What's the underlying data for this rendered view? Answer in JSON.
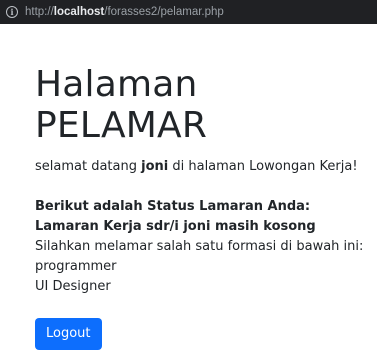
{
  "browser": {
    "url_scheme": "http://",
    "url_host": "localhost",
    "url_path": "/forasses2/pelamar.php"
  },
  "page": {
    "title": "Halaman PELAMAR",
    "welcome_prefix": "selamat datang ",
    "username": "joni",
    "welcome_suffix": " di halaman Lowongan Kerja!",
    "status_heading": "Berikut adalah Status Lamaran Anda:",
    "status_empty": "Lamaran Kerja sdr/i joni masih kosong",
    "apply_prompt": "Silahkan melamar salah satu formasi di bawah ini:",
    "formations": [
      "programmer",
      "UI Designer"
    ],
    "logout_label": "Logout"
  },
  "colors": {
    "primary_button": "#0d6efd",
    "text": "#212529",
    "addressbar_bg": "#202124"
  }
}
